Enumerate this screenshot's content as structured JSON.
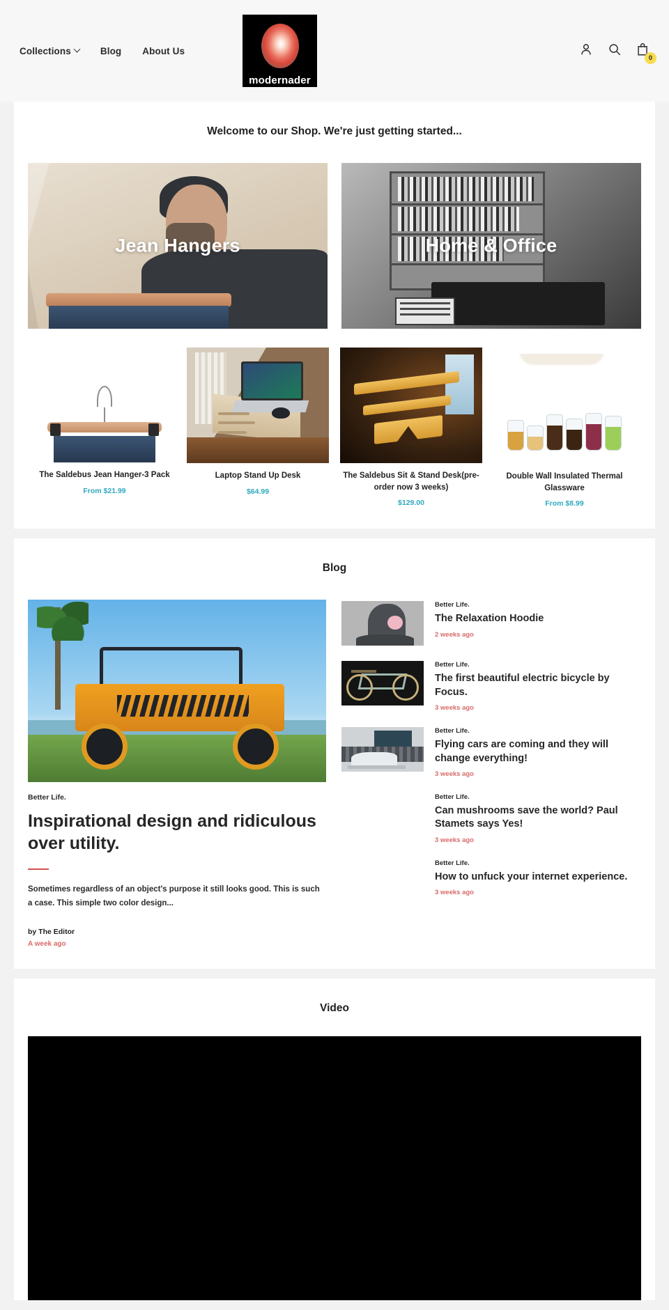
{
  "header": {
    "nav": [
      {
        "label": "Collections",
        "has_caret": true
      },
      {
        "label": "Blog",
        "has_caret": false
      },
      {
        "label": "About Us",
        "has_caret": false
      }
    ],
    "logo_text": "modernader",
    "cart_count": "0",
    "icons": [
      "account-icon",
      "search-icon",
      "cart-icon"
    ]
  },
  "shop": {
    "title": "Welcome to our Shop. We're just getting started...",
    "collections": [
      {
        "label": "Jean Hangers"
      },
      {
        "label": "Home & Office"
      }
    ],
    "products": [
      {
        "title": "The Saldebus Jean Hanger-3 Pack",
        "price": "From $21.99"
      },
      {
        "title": "Laptop Stand Up Desk",
        "price": "$64.99"
      },
      {
        "title": "The Saldebus Sit & Stand Desk(pre-order now 3 weeks)",
        "price": "$129.00"
      },
      {
        "title": "Double Wall Insulated Thermal Glassware",
        "price": "From $8.99"
      }
    ]
  },
  "blog": {
    "title": "Blog",
    "featured": {
      "category": "Better Life.",
      "title": "Inspirational design and ridiculous over utility.",
      "excerpt": "Sometimes regardless of an object's purpose it still looks good. This is such a case. This simple two color design...",
      "author": "by The Editor",
      "date": "A week ago"
    },
    "items": [
      {
        "category": "Better Life.",
        "title": "The Relaxation Hoodie",
        "date": "2 weeks ago",
        "has_thumb": true
      },
      {
        "category": "Better Life.",
        "title": "The first beautiful electric bicycle by Focus.",
        "date": "3 weeks ago",
        "has_thumb": true
      },
      {
        "category": "Better Life.",
        "title": "Flying cars are coming and they will change everything!",
        "date": "3 weeks ago",
        "has_thumb": true
      },
      {
        "category": "Better Life.",
        "title": "Can mushrooms save the world? Paul Stamets says Yes!",
        "date": "3 weeks ago",
        "has_thumb": false
      },
      {
        "category": "Better Life.",
        "title": "How to unfuck your internet experience.",
        "date": "3 weeks ago",
        "has_thumb": false
      }
    ]
  },
  "video": {
    "title": "Video"
  },
  "colors": {
    "price": "#2fa8bd",
    "date": "#d96a68",
    "badge": "#f7dc4f",
    "page_bg": "#f2f2f2",
    "card_bg": "#ffffff"
  }
}
